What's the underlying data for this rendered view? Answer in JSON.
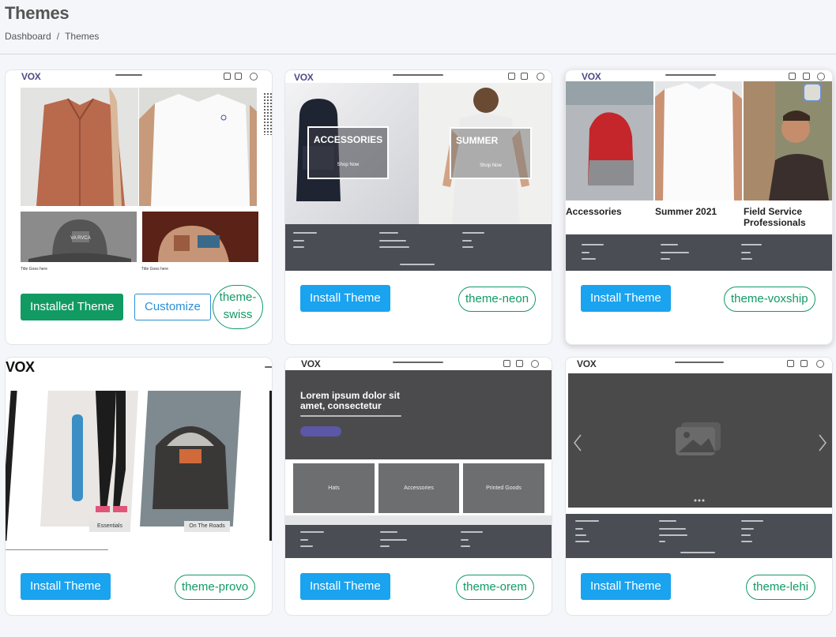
{
  "page": {
    "title": "Themes"
  },
  "breadcrumb": {
    "items": [
      "Dashboard",
      "Themes"
    ],
    "separator": "/"
  },
  "colors": {
    "primary_button": "#1aa3ef",
    "installed_button": "#129a63",
    "tag_green": "#139a65",
    "footer_band": "#4b4d55",
    "logo": "#4f4a86"
  },
  "themes": [
    {
      "tag": "theme-swiss",
      "installed_label": "Installed Theme",
      "customize_label": "Customize",
      "preview": {
        "logo": "VOX",
        "captions": [
          "Title Goes here",
          "Title Goes here"
        ]
      }
    },
    {
      "tag": "theme-neon",
      "install_label": "Install Theme",
      "preview": {
        "logo": "VOX",
        "banners": [
          {
            "title": "ACCESSORIES",
            "cta": "Shop Now"
          },
          {
            "title": "SUMMER",
            "cta": "Shop Now"
          }
        ]
      }
    },
    {
      "tag": "theme-voxship",
      "install_label": "Install Theme",
      "preview": {
        "logo": "VOX",
        "captions": [
          "Accessories",
          "Summer 2021",
          "Field Service Professionals"
        ]
      }
    },
    {
      "tag": "theme-provo",
      "install_label": "Install Theme",
      "preview": {
        "logo": "VOX",
        "captions": [
          "Essentials",
          "On The Roads"
        ]
      }
    },
    {
      "tag": "theme-orem",
      "install_label": "Install Theme",
      "preview": {
        "logo": "VOX",
        "hero": "Lorem ipsum dolor sit amet, consectetur",
        "tiles": [
          "Hats",
          "Accessories",
          "Printed Goods"
        ]
      }
    },
    {
      "tag": "theme-lehi",
      "install_label": "Install Theme",
      "preview": {
        "logo": "VOX"
      }
    }
  ]
}
